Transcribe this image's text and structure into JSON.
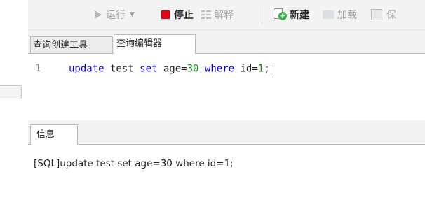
{
  "toolbar": {
    "run_label": "运行",
    "stop_label": "停止",
    "explain_label": "解释",
    "new_label": "新建",
    "load_label": "加载",
    "save_label": "保"
  },
  "tabs": [
    {
      "label": "查询创建工具"
    },
    {
      "label": "查询编辑器"
    }
  ],
  "editor": {
    "line_number": "1",
    "code": {
      "kw_update": "update",
      "t1": " test ",
      "kw_set": "set",
      "t2": " age=",
      "n30": "30",
      "t3": " ",
      "kw_where": "where",
      "t4": " id=",
      "n1": "1",
      "t5": ";"
    }
  },
  "message_panel": {
    "tab_label": "信息",
    "text": "[SQL]update test set age=30 where id=1;"
  }
}
